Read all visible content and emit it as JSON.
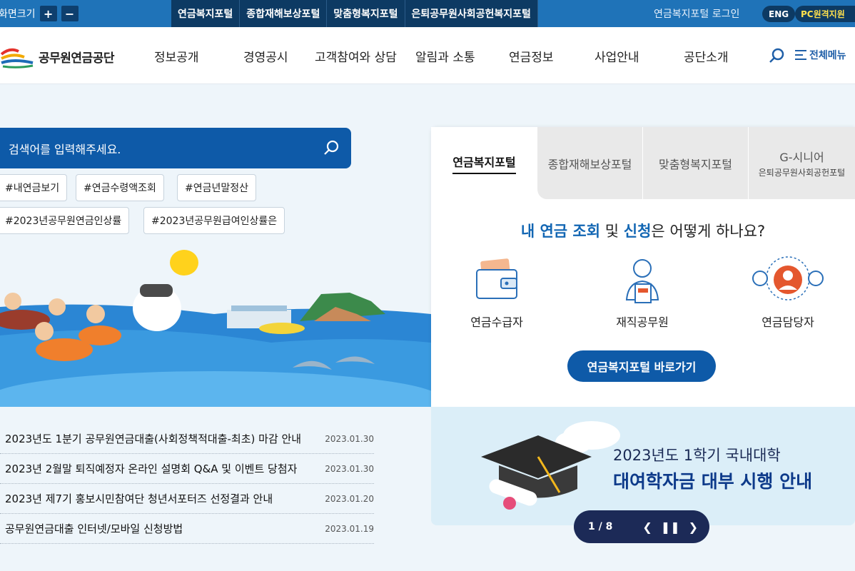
{
  "topbar": {
    "zoom_label": "화면크기",
    "zoom_in": "+",
    "zoom_out": "−",
    "portals": [
      "연금복지포털",
      "종합재해보상포털",
      "맞춤형복지포털",
      "은퇴공무원사회공헌복지포털"
    ],
    "login": "연금복지포털 로그인",
    "eng": "ENG",
    "pc": "PC원격지원"
  },
  "header": {
    "logo": "공무원연금공단",
    "menu": [
      "정보공개",
      "경영공시",
      "고객참여와 상담",
      "알림과 소통",
      "연금정보",
      "사업안내",
      "공단소개"
    ],
    "all_menu": "전체메뉴"
  },
  "search": {
    "placeholder": "검색어를 입력해주세요.",
    "tags": [
      "#내연금보기",
      "#연금수령액조회",
      "#연금년말정산",
      "#2023년공무원연금인상률",
      "#2023년공무원급여인상률은"
    ]
  },
  "notices": [
    {
      "title": "2023년도 1분기 공무원연금대출(사회정책적대출-최초) 마감 안내",
      "date": "2023.01.30"
    },
    {
      "title": "2023년 2월말 퇴직예정자 온라인 설명회 Q&A 및 이벤트 당첨자",
      "date": "2023.01.30"
    },
    {
      "title": "2023년 제7기 홍보시민참여단 청년서포터즈 선정결과 안내",
      "date": "2023.01.20"
    },
    {
      "title": "공무원연금대출 인터넷/모바일 신청방법",
      "date": "2023.01.19"
    }
  ],
  "panel": {
    "tabs": [
      {
        "label": "연금복지포털",
        "sub": ""
      },
      {
        "label": "종합재해보상포털",
        "sub": ""
      },
      {
        "label": "맞춤형복지포털",
        "sub": ""
      },
      {
        "label": "G-시니어",
        "sub": "은퇴공무원사회공헌포털"
      }
    ],
    "question": {
      "p1": "내 연금 조회",
      "p2": " 및 ",
      "p3": "신청",
      "p4": "은 어떻게 하나요?"
    },
    "roles": [
      "연금수급자",
      "재직공무원",
      "연금담당자"
    ],
    "button": "연금복지포털 바로가기"
  },
  "banner": {
    "line1": "2023년도 1학기 국내대학",
    "line2": "대여학자금 대부 시행 안내",
    "pager": "1 / 8"
  },
  "colors": {
    "primary": "#1f73b8",
    "dark": "#0d3a63",
    "accent": "#0e5aa8",
    "pc_yellow": "#ffe14d"
  }
}
